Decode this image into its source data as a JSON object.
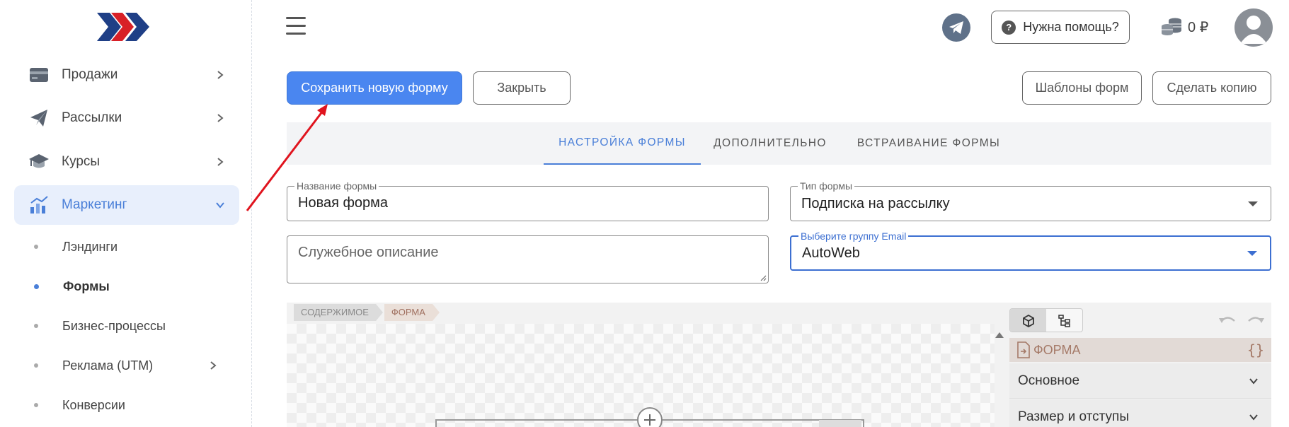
{
  "sidebar": {
    "items": [
      {
        "label": "Продажи",
        "icon": "credit-card-icon"
      },
      {
        "label": "Рассылки",
        "icon": "paper-plane-icon"
      },
      {
        "label": "Курсы",
        "icon": "graduation-cap-icon"
      },
      {
        "label": "Маркетинг",
        "icon": "chart-icon",
        "active": true
      }
    ],
    "subitems": [
      {
        "label": "Лэндинги"
      },
      {
        "label": "Формы",
        "active": true
      },
      {
        "label": "Бизнес-процессы"
      },
      {
        "label": "Реклама (UTM)"
      },
      {
        "label": "Конверсии"
      }
    ]
  },
  "header": {
    "help_label": "Нужна помощь?",
    "balance": "0 ₽"
  },
  "actions": {
    "save_label": "Сохранить новую форму",
    "close_label": "Закрыть",
    "templates_label": "Шаблоны форм",
    "copy_label": "Сделать копию"
  },
  "tabs": [
    {
      "label": "НАСТРОЙКА ФОРМЫ",
      "active": true
    },
    {
      "label": "ДОПОЛНИТЕЛЬНО"
    },
    {
      "label": "ВСТРАИВАНИЕ ФОРМЫ"
    }
  ],
  "form": {
    "name_label": "Название формы",
    "name_value": "Новая форма",
    "type_label": "Тип формы",
    "type_value": "Подписка на рассылку",
    "description_placeholder": "Служебное описание",
    "group_label": "Выберите группу Email",
    "group_value": "AutoWeb"
  },
  "editor": {
    "crumbs": [
      "СОДЕРЖИМОЕ",
      "ФОРМА"
    ],
    "panel_title": "ФОРМА",
    "panel_braces": "{}",
    "sections": [
      "Основное",
      "Размер и отступы"
    ]
  },
  "colors": {
    "accent": "#4a86f0",
    "active_nav_bg": "#e8effc",
    "annotation_arrow": "#e0141e"
  }
}
